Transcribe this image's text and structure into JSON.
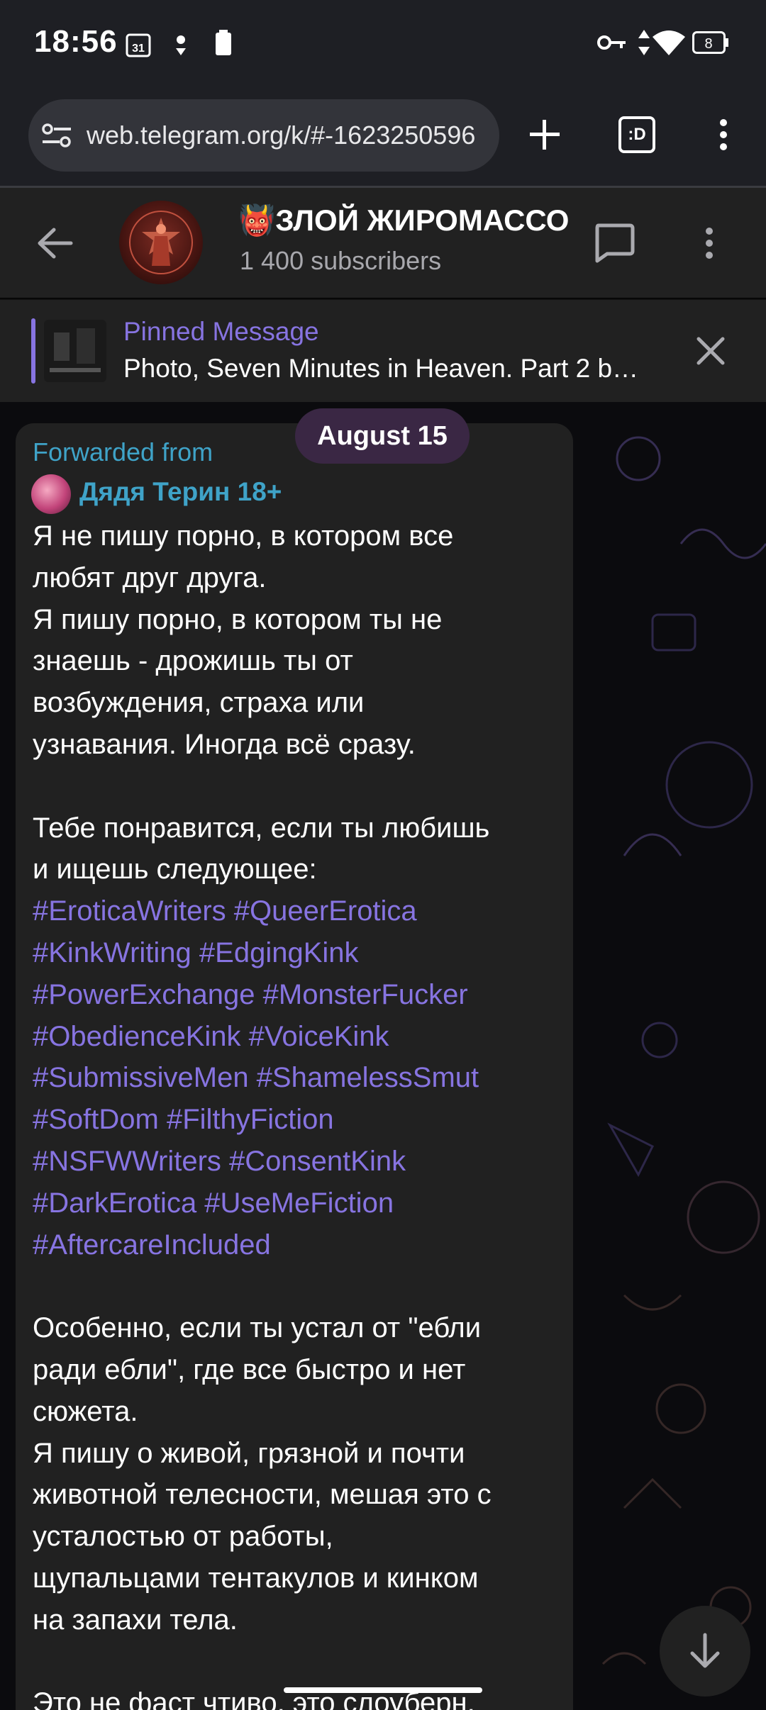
{
  "status_bar": {
    "time": "18:56",
    "calendar_badge": "31",
    "battery_level": "8"
  },
  "browser": {
    "url": "web.telegram.org/k/#-1623250596",
    "tab_switcher_label": ":D"
  },
  "channel": {
    "title": "👹ЗЛОЙ ЖИРОМАССО",
    "subscribers": "1 400 subscribers"
  },
  "pinned": {
    "title": "Pinned Message",
    "text": "Photo, Seven Minutes in Heaven. Part 2 b…"
  },
  "date_pill": "August 15",
  "message": {
    "forwarded_label": "Forwarded from",
    "forwarded_author": "Дядя Терин 18+",
    "lines": [
      "Я не пишу порно, в котором все",
      "любят друг друга.",
      "Я пишу порно, в котором ты не",
      "знаешь - дрожишь ты от",
      "возбуждения, страха или",
      "узнавания. Иногда всё сразу.",
      "",
      "Тебе понравится, если ты любишь",
      "и ищешь следующее:"
    ],
    "hashtags": [
      "#EroticaWriters #QueerErotica",
      "#KinkWriting #EdgingKink",
      "#PowerExchange #MonsterFucker",
      "#ObedienceKink #VoiceKink",
      "#SubmissiveMen #ShamelessSmut",
      "#SoftDom #FilthyFiction",
      "#NSFWWriters #ConsentKink",
      "#DarkErotica #UseMeFiction",
      "#AftercareIncluded"
    ],
    "lines_after": [
      "",
      "Особенно, если ты устал от \"ебли",
      "ради ебли\", где все быстро и нет",
      "сюжета.",
      "Я пишу о живой, грязной и почти",
      "животной телесности, мешая это с",
      "усталостью от работы,",
      "щупальцами тентакулов и кинком",
      "на запахи тела.",
      "",
      "Это не фаст чтиво, это слоуберн,"
    ]
  },
  "colors": {
    "accent_purple": "#8774e1",
    "forward_blue": "#3fa3c8",
    "bubble_bg": "#212121",
    "date_pill_bg": "#3a2744"
  },
  "icons": {
    "site_settings": "tune-icon",
    "new_tab": "plus-icon",
    "menu": "more-vert-icon",
    "back": "arrow-left-icon",
    "comments": "chat-bubble-icon",
    "close": "close-icon",
    "scroll_down": "arrow-down-icon"
  }
}
